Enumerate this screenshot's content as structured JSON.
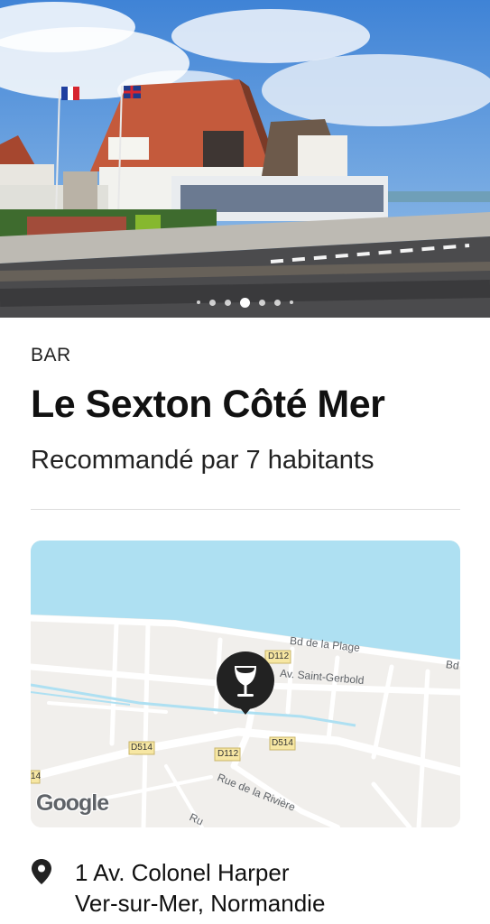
{
  "carousel": {
    "slide_count": 7,
    "active_index": 3
  },
  "place": {
    "category": "BAR",
    "name": "Le Sexton Côté Mer",
    "recommendation": "Recommandé par 7 habitants"
  },
  "map": {
    "labels": {
      "bd_plage": "Bd de la Plage",
      "bd_edge": "Bd",
      "saint_gerbold": "Av. Saint-Gerbold",
      "d112_top": "D112",
      "d112_bottom": "D112",
      "d514_left": "D514",
      "d514_right": "D514",
      "d514_edge": "14",
      "riviere": "Rue de la Rivière",
      "ru": "Ru"
    },
    "attribution": "Google",
    "marker_icon": "wine-glass-icon",
    "colors": {
      "water": "#aee0f2",
      "land": "#f1efec",
      "road": "#ffffff",
      "marker": "#222222"
    }
  },
  "address": {
    "icon": "location-pin-icon",
    "line1": "1 Av. Colonel Harper",
    "line2": "Ver-sur-Mer, Normandie"
  }
}
